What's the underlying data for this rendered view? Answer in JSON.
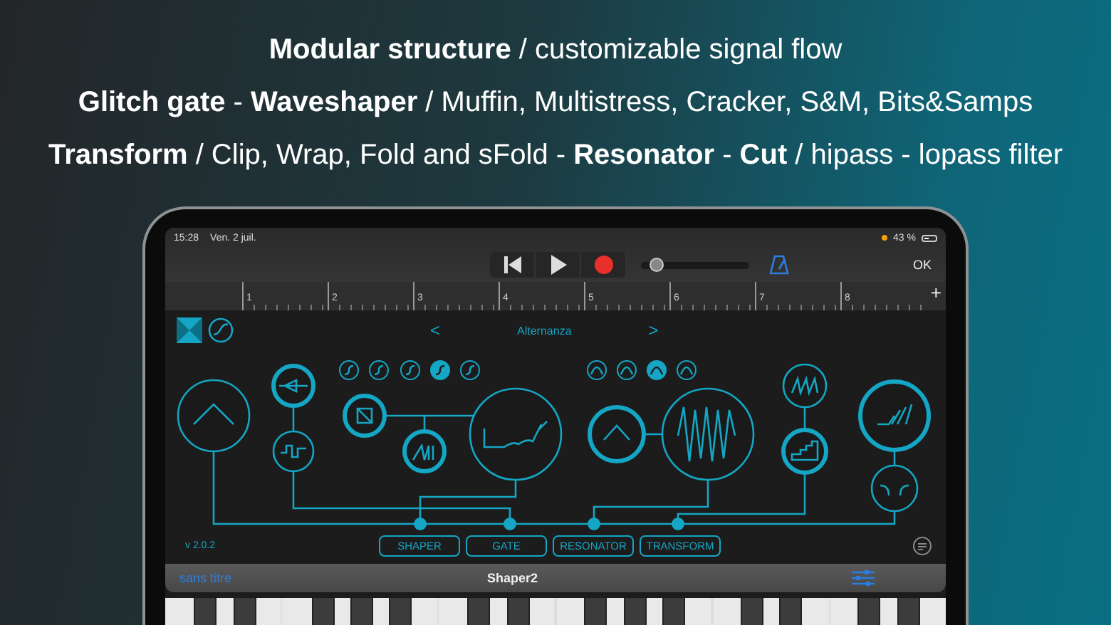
{
  "headlines": [
    "**Modular structure** / customizable signal flow",
    "**Glitch gate** - **Waveshaper** / Muffin, Multistress, Cracker, S&M, Bits&Samps",
    "**Transform** / Clip, Wrap, Fold and sFold - **Resonator** - **Cut** / hipass - lopass filter"
  ],
  "status_bar": {
    "time": "15:28",
    "date": "Ven. 2 juil.",
    "battery": "43 %"
  },
  "transport": {
    "position": {
      "level": 0.15
    },
    "done": "OK"
  },
  "ruler": {
    "bars": [
      "1",
      "2",
      "3",
      "4",
      "5",
      "6",
      "7",
      "8"
    ],
    "add": "+"
  },
  "preset": {
    "previous": "<",
    "name": "Alternanza",
    "next": ">"
  },
  "shaper_curves": [
    {
      "selected": false
    },
    {
      "selected": false
    },
    {
      "selected": false
    },
    {
      "selected": true
    },
    {
      "selected": false
    }
  ],
  "filter_shapes": [
    {
      "selected": false
    },
    {
      "selected": false
    },
    {
      "selected": true
    },
    {
      "selected": false
    }
  ],
  "version": "v 2.0.2",
  "section_buttons": [
    "SHAPER",
    "GATE",
    "RESONATOR",
    "TRANSFORM"
  ],
  "bottom_bar": {
    "project": "sans titre",
    "title": "Shaper2"
  }
}
